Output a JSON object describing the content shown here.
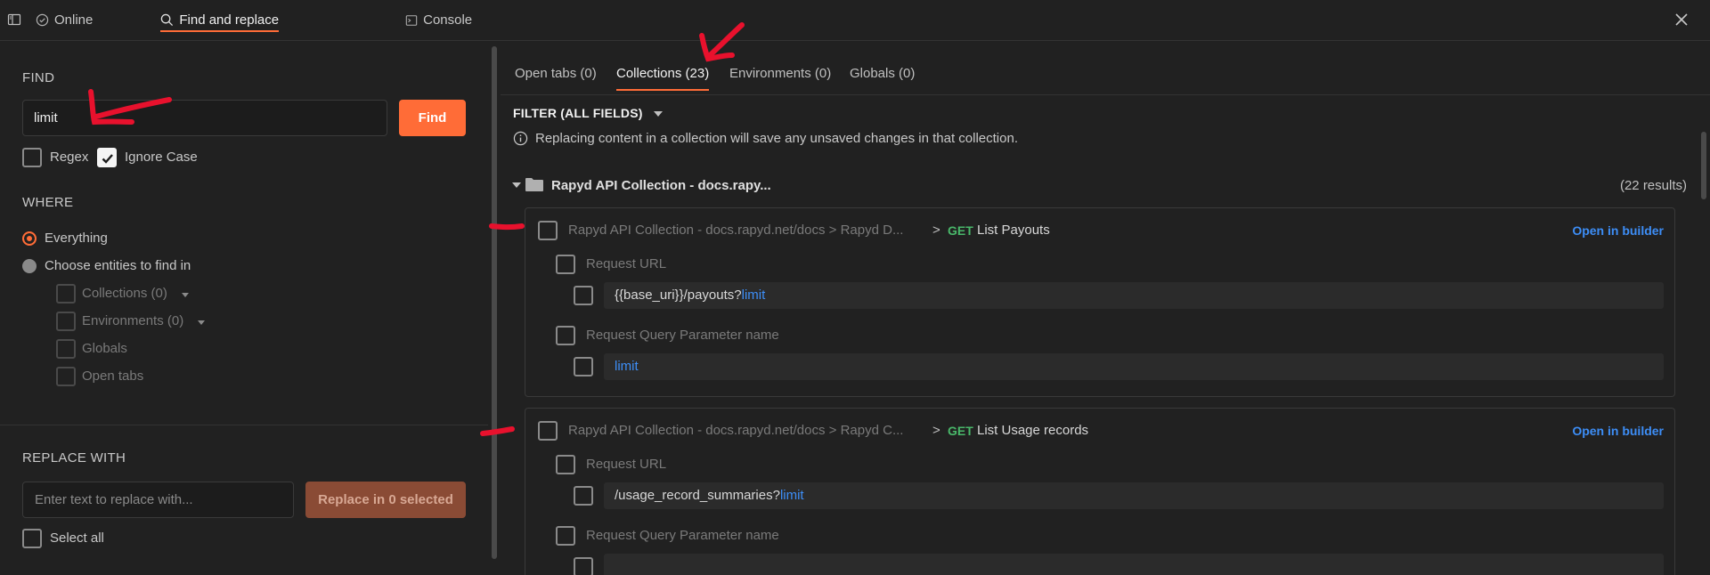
{
  "topbar": {
    "online_label": "Online",
    "find_label": "Find and replace",
    "console_label": "Console"
  },
  "find": {
    "heading": "FIND",
    "value": "limit",
    "button": "Find",
    "regex_label": "Regex",
    "regex_checked": false,
    "ignore_case_label": "Ignore Case",
    "ignore_case_checked": true
  },
  "where": {
    "heading": "WHERE",
    "everything_label": "Everything",
    "choose_label": "Choose entities to find in",
    "entities": [
      {
        "label": "Collections (0)",
        "has_dropdown": true
      },
      {
        "label": "Environments (0)",
        "has_dropdown": true
      },
      {
        "label": "Globals",
        "has_dropdown": false
      },
      {
        "label": "Open tabs",
        "has_dropdown": false
      }
    ]
  },
  "replace": {
    "heading": "REPLACE WITH",
    "placeholder": "Enter text to replace with...",
    "button": "Replace in 0 selected",
    "select_all_label": "Select all"
  },
  "tabs": [
    {
      "label": "Open tabs (0)",
      "active": false
    },
    {
      "label": "Collections (23)",
      "active": true
    },
    {
      "label": "Environments (0)",
      "active": false
    },
    {
      "label": "Globals (0)",
      "active": false
    }
  ],
  "filter_label": "FILTER (ALL FIELDS)",
  "info_text": "Replacing content in a collection will save any unsaved changes in that collection.",
  "collection": {
    "name": "Rapyd API Collection - docs.rapy...",
    "results": "(22 results)"
  },
  "results": [
    {
      "path": "Rapyd API Collection - docs.rapyd.net/docs > Rapyd D...",
      "sep": ">",
      "method": "GET",
      "name": "List Payouts",
      "open_label": "Open in builder",
      "fields": [
        {
          "label": "Request URL",
          "value_pre": "{{base_uri}}/payouts?",
          "value_match": "limit"
        },
        {
          "label": "Request Query Parameter name",
          "value_pre": "",
          "value_match": "limit"
        }
      ]
    },
    {
      "path": "Rapyd API Collection - docs.rapyd.net/docs > Rapyd C...",
      "sep": ">",
      "method": "GET",
      "name": "List Usage records",
      "open_label": "Open in builder",
      "fields": [
        {
          "label": "Request URL",
          "value_pre": "/usage_record_summaries?",
          "value_match": "limit"
        },
        {
          "label": "Request Query Parameter name",
          "value_pre": "",
          "value_match": ""
        }
      ]
    }
  ],
  "colors": {
    "accent": "#ff6c37",
    "link": "#3d8ef7",
    "method_get": "#49b86a",
    "annotation": "#e8112d"
  }
}
